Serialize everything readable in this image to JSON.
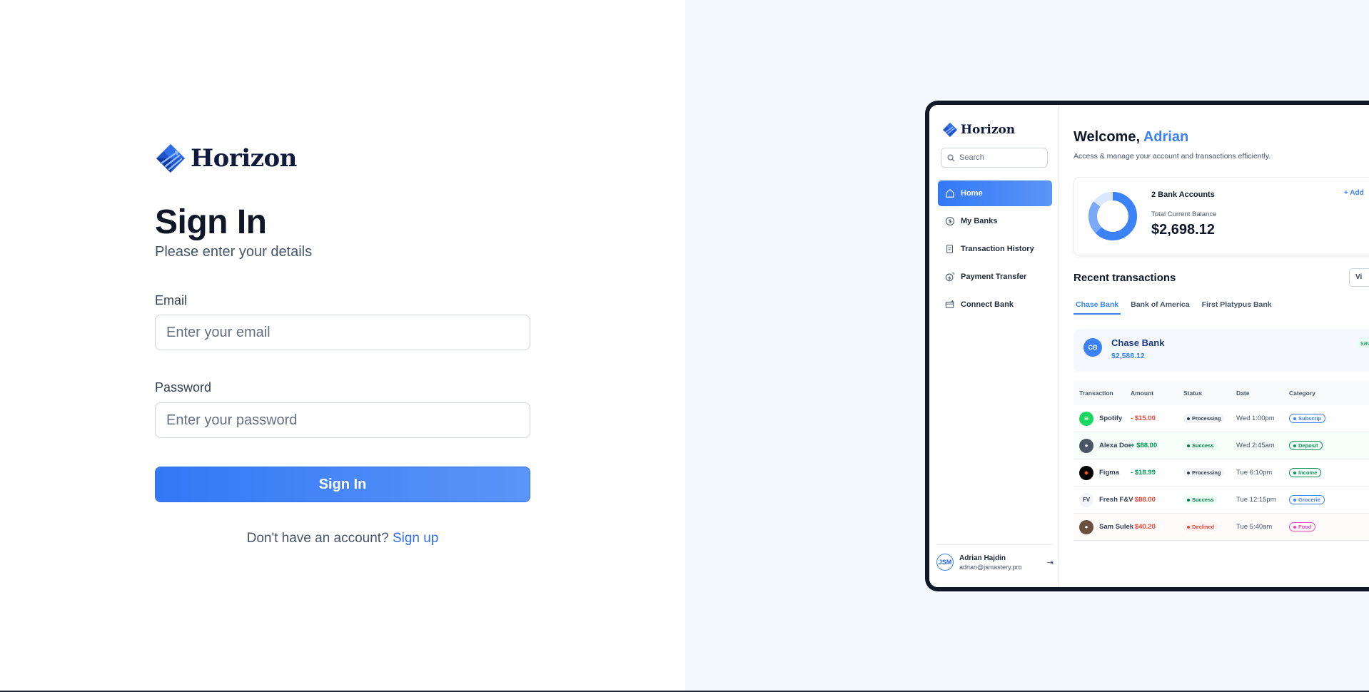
{
  "brand": {
    "name": "Horizon"
  },
  "signin": {
    "title": "Sign In",
    "subtitle": "Please enter your details",
    "email_label": "Email",
    "email_placeholder": "Enter your email",
    "email_value": "",
    "password_label": "Password",
    "password_placeholder": "Enter your password",
    "password_value": "",
    "submit_label": "Sign In",
    "footer_text": "Don't have an account?",
    "footer_link": "Sign up"
  },
  "colors": {
    "accent": "#3378f5",
    "brand_navy": "#0f1a3d",
    "right_bg": "#f3f8fc",
    "link": "#2f6fe8"
  },
  "preview": {
    "brand": "Horizon",
    "search_placeholder": "Search",
    "nav": [
      {
        "label": "Home",
        "icon": "home-icon",
        "active": true
      },
      {
        "label": "My Banks",
        "icon": "dollar-circle-icon",
        "active": false
      },
      {
        "label": "Transaction History",
        "icon": "receipt-icon",
        "active": false
      },
      {
        "label": "Payment Transfer",
        "icon": "money-send-icon",
        "active": false
      },
      {
        "label": "Connect Bank",
        "icon": "card-add-icon",
        "active": false
      }
    ],
    "user": {
      "initials": "JSM",
      "name": "Adrian Hajdin",
      "email": "adrian@jsmastery.pro"
    },
    "welcome_prefix": "Welcome,",
    "welcome_name": "Adrian",
    "welcome_sub": "Access & manage your account and transactions efficiently.",
    "balance": {
      "accounts": "2 Bank Accounts",
      "label": "Total Current Balance",
      "value": "$2,698.12",
      "add_label": "+ Add"
    },
    "recent_title": "Recent transactions",
    "view_all": "Vi",
    "bank_tabs": [
      "Chase Bank",
      "Bank of America",
      "First Platypus Bank"
    ],
    "active_bank": {
      "initials": "CB",
      "name": "Chase Bank",
      "balance": "$2,588.12",
      "type": "savi"
    },
    "table": {
      "headers": [
        "Transaction",
        "Amount",
        "Status",
        "Date",
        "Category"
      ],
      "rows": [
        {
          "name": "Spotify",
          "icon": "spotify-icon",
          "amount": "- $15.00",
          "sign": "neg",
          "status": "Processing",
          "date": "Wed 1:00pm",
          "category": "Subscrip",
          "cat_color": "#3b82f6",
          "row_tint": ""
        },
        {
          "name": "Alexa Doe",
          "icon": "avatar-icon",
          "amount": "+ $88.00",
          "sign": "pos",
          "status": "Success",
          "date": "Wed 2:45am",
          "category": "Deposit",
          "cat_color": "#039855",
          "row_tint": "pos"
        },
        {
          "name": "Figma",
          "icon": "figma-icon",
          "amount": "- $18.99",
          "sign": "pos",
          "status": "Processing",
          "date": "Tue 6:10pm",
          "category": "Income",
          "cat_color": "#039855",
          "row_tint": ""
        },
        {
          "name": "Fresh F&V",
          "icon": "initials-icon",
          "amount": "- $88.00",
          "sign": "neg",
          "status": "Success",
          "date": "Tue 12:15pm",
          "category": "Grocerie",
          "cat_color": "#3b82f6",
          "row_tint": ""
        },
        {
          "name": "Sam Sulek",
          "icon": "avatar-icon",
          "amount": "- $40.20",
          "sign": "neg",
          "status": "Declined",
          "date": "Tue 5:40am",
          "category": "Food",
          "cat_color": "#ee46bc",
          "row_tint": "neg"
        }
      ]
    }
  }
}
